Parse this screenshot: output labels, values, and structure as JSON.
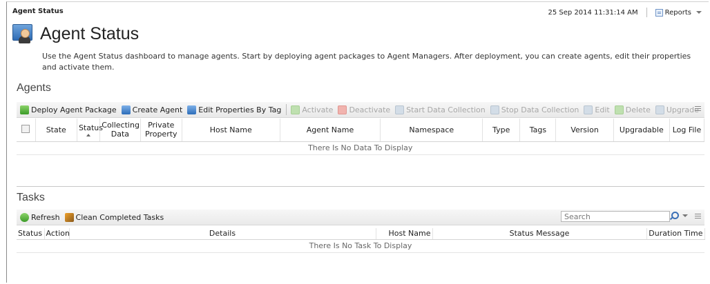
{
  "header": {
    "breadcrumb": "Agent Status",
    "timestamp": "25 Sep 2014 11:31:14 AM",
    "reports_label": "Reports",
    "page_title": "Agent Status",
    "description": "Use the Agent Status dashboard to manage agents. Start by deploying agent packages to Agent Managers. After deployment, you can create agents, edit their properties and activate them."
  },
  "agents": {
    "title": "Agents",
    "toolbar": [
      {
        "label": "Deploy Agent Package",
        "icon": "deploy-package-icon",
        "enabled": true
      },
      {
        "label": "Create Agent",
        "icon": "create-agent-icon",
        "enabled": true
      },
      {
        "label": "Edit Properties By Tag",
        "icon": "edit-tag-icon",
        "enabled": true
      },
      {
        "label": "Activate",
        "icon": "activate-icon",
        "enabled": false
      },
      {
        "label": "Deactivate",
        "icon": "deactivate-icon",
        "enabled": false
      },
      {
        "label": "Start Data Collection",
        "icon": "play-icon",
        "enabled": false
      },
      {
        "label": "Stop Data Collection",
        "icon": "pause-icon",
        "enabled": false
      },
      {
        "label": "Edit",
        "icon": "edit-icon",
        "enabled": false
      },
      {
        "label": "Delete",
        "icon": "delete-icon",
        "enabled": false
      },
      {
        "label": "Upgrade",
        "icon": "upgrade-icon",
        "enabled": false
      }
    ],
    "columns": [
      "State",
      "Status",
      "Collecting Data",
      "Private Property",
      "Host Name",
      "Agent Name",
      "Namespace",
      "Type",
      "Tags",
      "Version",
      "Upgradable",
      "Log File"
    ],
    "empty_text": "There Is No Data To Display"
  },
  "tasks": {
    "title": "Tasks",
    "refresh_label": "Refresh",
    "clean_label": "Clean Completed Tasks",
    "search_placeholder": "Search",
    "columns": [
      "Status",
      "Action",
      "Details",
      "Host Name",
      "Status Message",
      "Duration Time"
    ],
    "empty_text": "There Is No Task To Display"
  }
}
